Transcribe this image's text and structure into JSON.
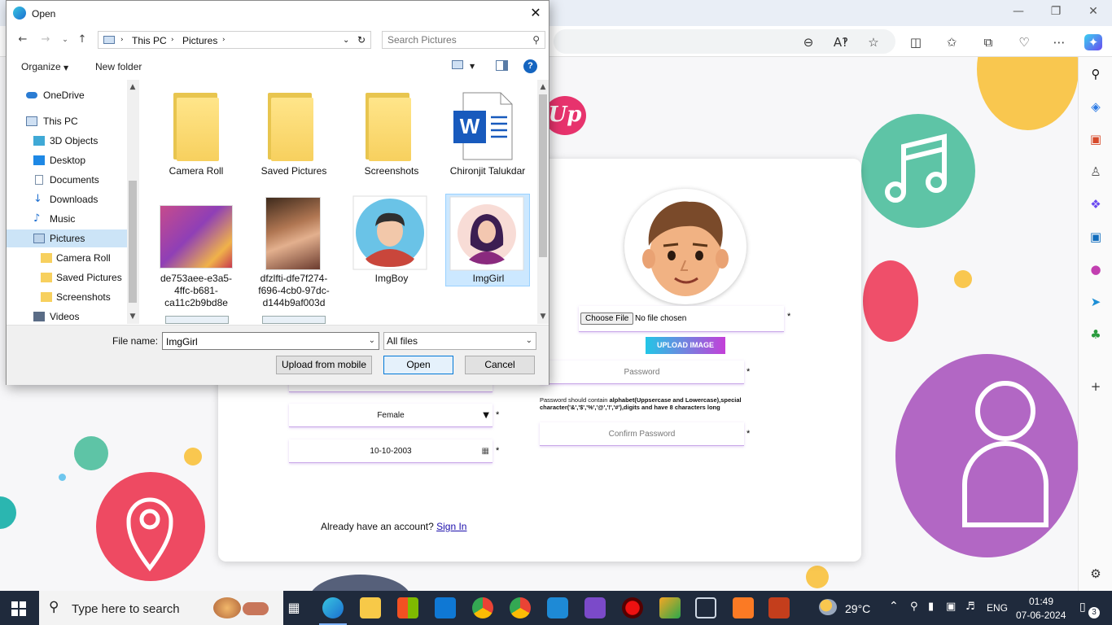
{
  "dialog": {
    "title": "Open",
    "path": [
      "This PC",
      "Pictures"
    ],
    "search_placeholder": "Search Pictures",
    "organize_label": "Organize",
    "new_folder_label": "New folder",
    "nav_items": [
      {
        "label": "OneDrive",
        "icon": "onedrive-icon"
      },
      {
        "label": "This PC",
        "icon": "computer-icon"
      },
      {
        "label": "3D Objects",
        "icon": "cube-icon"
      },
      {
        "label": "Desktop",
        "icon": "desktop-icon"
      },
      {
        "label": "Documents",
        "icon": "document-icon"
      },
      {
        "label": "Downloads",
        "icon": "download-icon"
      },
      {
        "label": "Music",
        "icon": "music-icon"
      },
      {
        "label": "Pictures",
        "icon": "pictures-icon"
      },
      {
        "label": "Camera Roll",
        "icon": "folder-icon"
      },
      {
        "label": "Saved Pictures",
        "icon": "folder-icon"
      },
      {
        "label": "Screenshots",
        "icon": "folder-icon"
      },
      {
        "label": "Videos",
        "icon": "video-icon"
      }
    ],
    "files": [
      {
        "name": "Camera Roll",
        "kind": "folder"
      },
      {
        "name": "Saved Pictures",
        "kind": "folder"
      },
      {
        "name": "Screenshots",
        "kind": "folder"
      },
      {
        "name": "Chironjit Talukdar",
        "kind": "word"
      },
      {
        "name": "de753aee-e3a5-4ffc-b681-ca11c2b9bd8e",
        "kind": "photo"
      },
      {
        "name": "dfzlfti-dfe7f274-f696-4cb0-97dc-d144b9af003d",
        "kind": "photo"
      },
      {
        "name": "ImgBoy",
        "kind": "avatar-boy"
      },
      {
        "name": "ImgGirl",
        "kind": "avatar-girl"
      }
    ],
    "file_name_label": "File name:",
    "file_name_value": "ImgGirl",
    "file_type_value": "All files",
    "upload_mobile_label": "Upload from mobile",
    "open_label": "Open",
    "cancel_label": "Cancel"
  },
  "page": {
    "logo_text": "Up",
    "choose_file_label": "Choose File",
    "no_file_text": "No file chosen",
    "upload_image_label": "UPLOAD IMAGE",
    "password_placeholder": "Password",
    "password_hint_prefix": "Password should contain",
    "password_hint_rest": "alphabet(Uppsercase and Lowercase),special character('&','$','%','@','!','#'),digits and have 8 characters long",
    "confirm_password_placeholder": "Confirm Password",
    "gender_value": "Female",
    "dob_value": "10-10-2003",
    "already_account_text": "Already have an account?",
    "sign_in_label": "Sign In",
    "required_mark": "*"
  },
  "taskbar": {
    "search_placeholder": "Type here to search",
    "weather": "29°C",
    "language": "ENG",
    "time": "01:49",
    "date": "07-06-2024",
    "notification_count": "3"
  },
  "colors": {
    "accent_pink": "#e7336d",
    "upload_gradient_start": "#22c6e6",
    "upload_gradient_end": "#c43fd8",
    "selection": "#cce8ff",
    "taskbar": "#1f2a3c"
  }
}
